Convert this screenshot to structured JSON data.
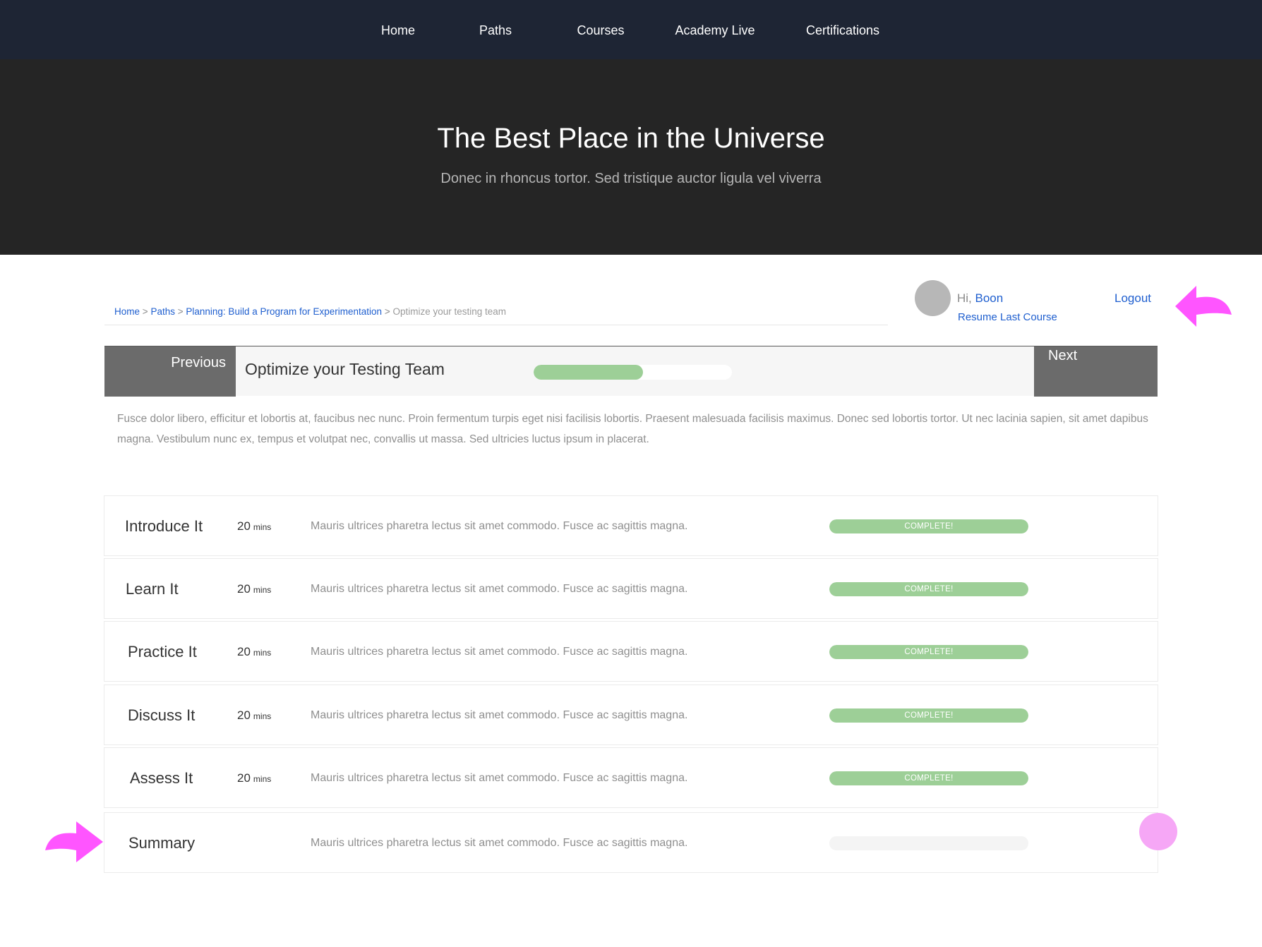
{
  "nav": {
    "items": [
      {
        "label": "Home"
      },
      {
        "label": "Paths"
      },
      {
        "label": "Courses"
      },
      {
        "label": "Academy Live"
      },
      {
        "label": "Certifications"
      }
    ]
  },
  "hero": {
    "title": "The Best Place in the Universe",
    "subtitle": "Donec in rhoncus tortor. Sed tristique auctor ligula vel viverra"
  },
  "breadcrumb": {
    "items": [
      "Home",
      "Paths",
      "Planning: Build a Program for Experimentation"
    ],
    "separator": ">",
    "current": "Optimize your testing team"
  },
  "user": {
    "greeting": "Hi,",
    "name": "Boon",
    "resume_label": "Resume Last Course",
    "logout_label": "Logout",
    "avatar_color": "#b7b7b7"
  },
  "course": {
    "prev_label": "Previous",
    "next_label": "Next",
    "title": "Optimize your Testing Team",
    "progress": 0.55,
    "description": "Fusce dolor libero, efficitur et lobortis at, faucibus nec nunc. Proin fermentum turpis eget nisi facilisis lobortis. Praesent malesuada facilisis maximus. Donec sed lobortis tortor. Ut nec lacinia sapien, sit amet dapibus magna. Vestibulum nunc ex, tempus et volutpat nec, convallis ut massa. Sed ultricies luctus ipsum in placerat."
  },
  "modules": [
    {
      "name": "Introduce It",
      "duration": "20",
      "unit": "mins",
      "description": "Mauris ultrices pharetra lectus sit amet commodo. Fusce ac sagittis magna.",
      "status": "COMPLETE!",
      "progress": 1
    },
    {
      "name": "Learn It",
      "duration": "20",
      "unit": "mins",
      "description": "Mauris ultrices pharetra lectus sit amet commodo. Fusce ac sagittis magna.",
      "status": "COMPLETE!",
      "progress": 1
    },
    {
      "name": "Practice It",
      "duration": "20",
      "unit": "mins",
      "description": "Mauris ultrices pharetra lectus sit amet commodo. Fusce ac sagittis magna.",
      "status": "COMPLETE!",
      "progress": 1
    },
    {
      "name": "Discuss It",
      "duration": "20",
      "unit": "mins",
      "description": "Mauris ultrices pharetra lectus sit amet commodo. Fusce ac sagittis magna.",
      "status": "COMPLETE!",
      "progress": 1
    },
    {
      "name": "Assess It",
      "duration": "20",
      "unit": "mins",
      "description": "Mauris ultrices pharetra lectus sit amet commodo. Fusce ac sagittis magna.",
      "status": "COMPLETE!",
      "progress": 1
    },
    {
      "name": "Summary",
      "duration": "",
      "unit": "",
      "description": "Mauris ultrices pharetra lectus sit amet commodo. Fusce ac sagittis magna.",
      "status": "",
      "progress": 0
    }
  ],
  "colors": {
    "nav_bg": "#1e2534",
    "hero_bg": "#252525",
    "link": "#1f5fcf",
    "progress_fill": "#9dcf97",
    "annotation_pink": "#ff55ff"
  },
  "annotations": {
    "icons": [
      "pink-arrow-left-icon",
      "pink-arrow-right-icon",
      "pink-circle-marker"
    ]
  }
}
